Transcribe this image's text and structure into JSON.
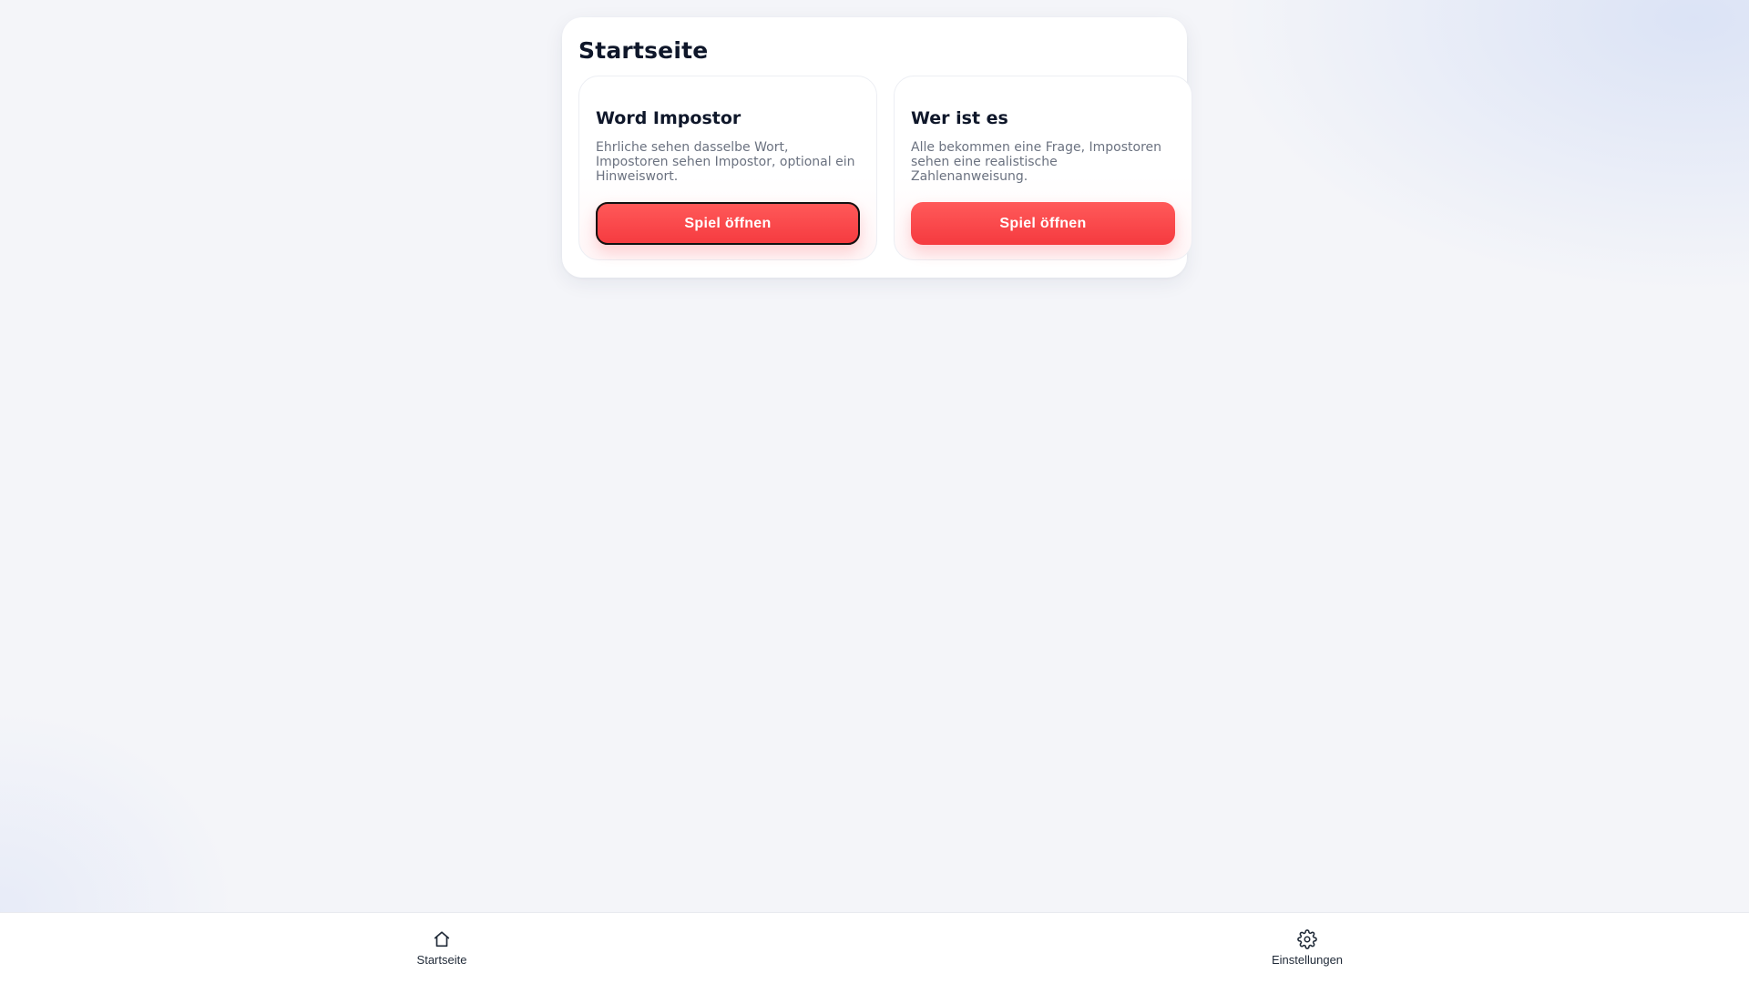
{
  "page": {
    "title": "Startseite"
  },
  "games": [
    {
      "title": "Word Impostor",
      "description": "Ehrliche sehen dasselbe Wort, Impostoren sehen Impostor, optional ein Hinweiswort.",
      "button_label": "Spiel öffnen"
    },
    {
      "title": "Wer ist es",
      "description": "Alle bekommen eine Frage, Impostoren sehen eine realistische Zahlenanweisung.",
      "button_label": "Spiel öffnen"
    }
  ],
  "nav": {
    "items": [
      {
        "label": "Startseite",
        "icon": "home-icon"
      },
      {
        "label": "Einstellungen",
        "icon": "gear-icon"
      }
    ]
  },
  "colors": {
    "accent": "#f53a3f",
    "text_primary": "#0f172a",
    "text_muted": "#6b7280",
    "background": "#f4f5f9"
  }
}
